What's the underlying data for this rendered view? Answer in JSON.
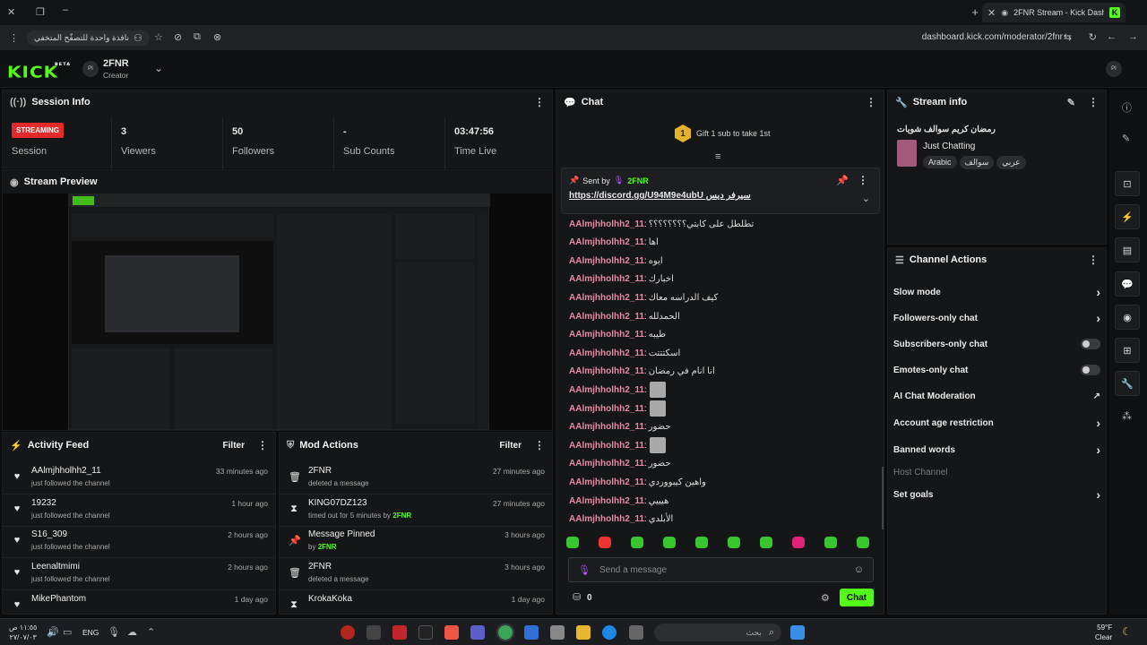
{
  "browser": {
    "tab_title": "2FNR Stream - Kick Dashbo",
    "url": "dashboard.kick.com/moderator/2fnr",
    "incognito_label": "نافذة واحدة للتصفّح المتخفي"
  },
  "header": {
    "logo": "KICK",
    "logo_beta": "BETA",
    "channel_name": "2FNR",
    "channel_role": "Creator",
    "user_initials": "PI"
  },
  "session": {
    "title": "Session Info",
    "status_badge": "STREAMING",
    "session_label": "Session",
    "viewers_value": "3",
    "viewers_label": "Viewers",
    "followers_value": "50",
    "followers_label": "Followers",
    "subs_value": "-",
    "subs_label": "Sub Counts",
    "time_value": "03:47:56",
    "time_label": "Time Live"
  },
  "preview": {
    "title": "Stream Preview"
  },
  "activity": {
    "title": "Activity Feed",
    "filter": "Filter",
    "items": [
      {
        "name": "AAlmjhholhh2_11",
        "sub": "just followed the channel",
        "time": "33 minutes ago"
      },
      {
        "name": "19232",
        "sub": "just followed the channel",
        "time": "1 hour ago"
      },
      {
        "name": "S16_309",
        "sub": "just followed the channel",
        "time": "2 hours ago"
      },
      {
        "name": "Leenaltmimi",
        "sub": "just followed the channel",
        "time": "2 hours ago"
      },
      {
        "name": "MikePhantom",
        "sub": "",
        "time": "1 day ago"
      }
    ]
  },
  "mod": {
    "title": "Mod Actions",
    "filter": "Filter",
    "items": [
      {
        "name": "2FNR",
        "sub": "deleted a message",
        "by": "",
        "time": "27 minutes ago"
      },
      {
        "name": "KING07DZ123",
        "sub": "timed out for 5 minutes by",
        "by": "2FNR",
        "time": "27 minutes ago"
      },
      {
        "name": "Message Pinned",
        "sub": "by",
        "by": "2FNR",
        "time": "3 hours ago"
      },
      {
        "name": "2FNR",
        "sub": "deleted a message",
        "by": "",
        "time": "3 hours ago"
      },
      {
        "name": "KrokaKoka",
        "sub": "",
        "by": "",
        "time": "1 day ago"
      }
    ]
  },
  "chat": {
    "title": "Chat",
    "gift_count": "1",
    "gift_text": "Gift 1 sub to take 1st",
    "pinned_sent_by": "Sent by",
    "pinned_user": "2FNR",
    "pinned_text": "سيرفر ديس https://discord.gg/U94M9e4ubU",
    "messages": [
      {
        "user": "AAlmjhholhh2_11",
        "text": "تطلطل على كابتي؟؟؟؟؟؟؟؟",
        "emote": false
      },
      {
        "user": "AAlmjhholhh2_11",
        "text": "اها",
        "emote": false
      },
      {
        "user": "AAlmjhholhh2_11",
        "text": "ايوه",
        "emote": false
      },
      {
        "user": "AAlmjhholhh2_11",
        "text": "اخبارك",
        "emote": false
      },
      {
        "user": "AAlmjhholhh2_11",
        "text": "كيف الدراسه معاك",
        "emote": false
      },
      {
        "user": "AAlmjhholhh2_11",
        "text": "الحمدلله",
        "emote": false
      },
      {
        "user": "AAlmjhholhh2_11",
        "text": "طيبه",
        "emote": false
      },
      {
        "user": "AAlmjhholhh2_11",
        "text": "اسكتتتت",
        "emote": false
      },
      {
        "user": "AAlmjhholhh2_11",
        "text": "انا انام في رمضان",
        "emote": false
      },
      {
        "user": "AAlmjhholhh2_11",
        "text": "",
        "emote": true
      },
      {
        "user": "AAlmjhholhh2_11",
        "text": "",
        "emote": true
      },
      {
        "user": "AAlmjhholhh2_11",
        "text": "حضور",
        "emote": false
      },
      {
        "user": "AAlmjhholhh2_11",
        "text": "",
        "emote": true
      },
      {
        "user": "AAlmjhholhh2_11",
        "text": "حضور",
        "emote": false
      },
      {
        "user": "AAlmjhholhh2_11",
        "text": "واهين كيبووردي",
        "emote": false
      },
      {
        "user": "AAlmjhholhh2_11",
        "text": "هيييي",
        "emote": false
      },
      {
        "user": "AAlmjhholhh2_11",
        "text": "الأبلدي",
        "emote": false
      }
    ],
    "input_placeholder": "Send a message",
    "points": "0",
    "send_button": "Chat"
  },
  "stream_info": {
    "title": "Stream info",
    "stream_title": "رمضان كريم سوالف شويات",
    "category": "Just Chatting",
    "tags": [
      "Arabic",
      "سوالف",
      "عربي"
    ]
  },
  "channel_actions": {
    "title": "Channel Actions",
    "items": [
      {
        "label": "Slow mode",
        "control": "chevron"
      },
      {
        "label": "Followers-only chat",
        "control": "chevron"
      },
      {
        "label": "Subscribers-only chat",
        "control": "toggle"
      },
      {
        "label": "Emotes-only chat",
        "control": "toggle"
      },
      {
        "label": "AI Chat Moderation",
        "control": "external"
      },
      {
        "label": "Account age restriction",
        "control": "chevron"
      },
      {
        "label": "Banned words",
        "control": "chevron"
      },
      {
        "label": "Host Channel",
        "control": "none"
      },
      {
        "label": "Set goals",
        "control": "chevron"
      }
    ]
  },
  "taskbar": {
    "time": "١١:٥٥ ص",
    "date": "٢٧/٠٧/٠٣",
    "lang": "ENG",
    "search_placeholder": "بحث",
    "weather_temp": "59°F",
    "weather_text": "Clear"
  },
  "colors": {
    "accent": "#53fc18",
    "username": "#e68aa4",
    "streaming": "#e22a2a"
  }
}
